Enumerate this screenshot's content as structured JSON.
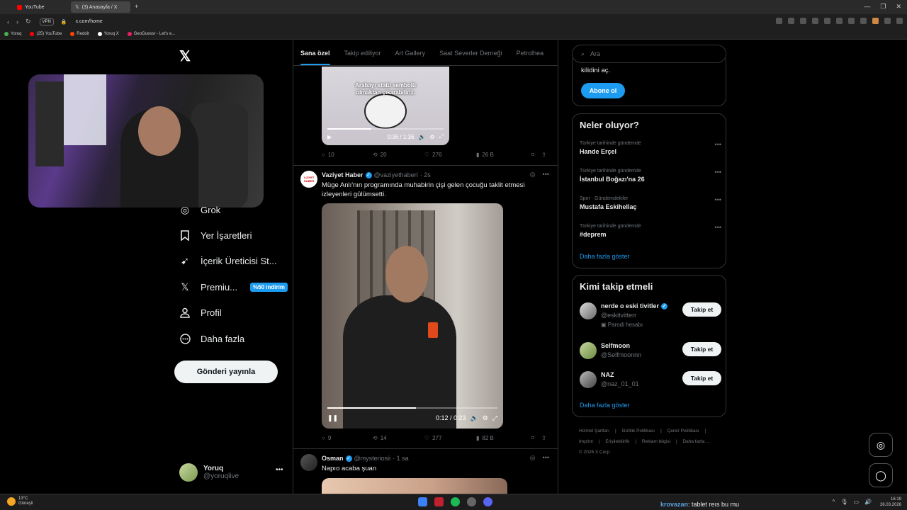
{
  "browser": {
    "tabs": [
      {
        "label": "YouTube"
      },
      {
        "label": "(3) Anasayfa / X"
      }
    ],
    "vpn": "VPN",
    "url": "x.com/home",
    "bookmarks": [
      "Yoruq",
      "(25) YouTube",
      "Reddit",
      "Yoruq X",
      "GeoGuessr - Let's e..."
    ]
  },
  "sidebar": {
    "items": [
      {
        "label": "Grok",
        "icon": "grok-icon"
      },
      {
        "label": "Yer İşaretleri",
        "icon": "bookmark-icon"
      },
      {
        "label": "İçerik Üreticisi St...",
        "icon": "rocket-icon"
      },
      {
        "label": "Premiu...",
        "icon": "x-icon",
        "badge": "%50 indirim"
      },
      {
        "label": "Profil",
        "icon": "person-icon"
      },
      {
        "label": "Daha fazla",
        "icon": "more-circle-icon"
      }
    ],
    "post_button": "Gönderi yayınla",
    "account": {
      "name": "Yoruq",
      "handle": "@yoruqlive"
    }
  },
  "feed": {
    "tabs": [
      "Sana özel",
      "Takip ediliyor",
      "Art Gallery",
      "Saat Severler Derneği",
      "Petrolhea"
    ],
    "tweet1": {
      "video_caption": "Arabayı statü sembolü olmaktan çıkarabiliriz.",
      "time": "0:36 / 1:36",
      "progress": 0.375,
      "replies": "10",
      "reposts": "20",
      "likes": "276",
      "views": "26 B"
    },
    "tweet2": {
      "avatar_text": "V.ZIYET HABER",
      "name": "Vaziyet Haber",
      "handle": "@vaziyethaberi",
      "time": "· 2s",
      "text": "Müge Anlı'nın programında muhabirin çişi gelen çocuğu taklit etmesi izleyenleri gülümsetti.",
      "video_time": "0:12 / 0:23",
      "progress": 0.52,
      "replies": "9",
      "reposts": "14",
      "likes": "277",
      "views": "82 B"
    },
    "tweet3": {
      "name": "Osman",
      "handle": "@mysteriosii",
      "time": "· 1 sa",
      "text": "Napıo acaba şuan"
    }
  },
  "right": {
    "search_placeholder": "Ara",
    "premium_text": "kilidini aç.",
    "subscribe": "Abone ol",
    "trends_title": "Neler oluyor?",
    "trends": [
      {
        "context": "Türkiye tarihinde gündemde",
        "name": "Hande Erçel"
      },
      {
        "context": "Türkiye tarihinde gündemde",
        "name": "İstanbul Boğazı'na 26"
      },
      {
        "context": "Spor · Gündemdekiler",
        "name": "Mustafa Eskihellaç"
      },
      {
        "context": "Türkiye tarihinde gündemde",
        "name": "#deprem"
      }
    ],
    "show_more": "Daha fazla göster",
    "who_title": "Kimi takip etmeli",
    "who": [
      {
        "name": "nerde o eski tivitler",
        "handle": "@eskitvitterr",
        "note": "Parodi hesabı",
        "verified": true
      },
      {
        "name": "Selfmoon",
        "handle": "@Selfmoonnn",
        "note": "",
        "verified": false
      },
      {
        "name": "NAZ",
        "handle": "@naz_01_01",
        "note": "",
        "verified": false
      }
    ],
    "follow": "Takip et",
    "footer": [
      "Hizmet Şartları",
      "Gizlilik Politikası",
      "Çerez Politikası",
      "Imprint",
      "Erişilebilirlik",
      "Reklam bilgisi",
      "Daha fazla ...",
      "© 2026 X Corp."
    ]
  },
  "taskbar": {
    "temp": "13°C",
    "weather": "Güneşli",
    "chat_user": "krovazan",
    "chat_msg": ": tablet reıs bu mu",
    "time": "16:19",
    "date": "26.03.2026"
  }
}
